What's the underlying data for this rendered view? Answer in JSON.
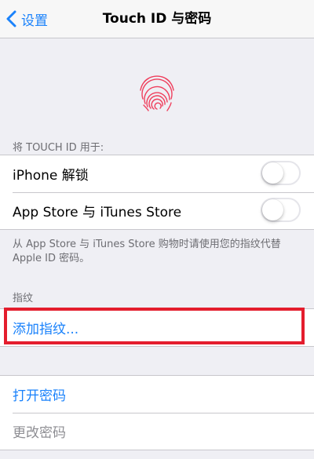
{
  "navbar": {
    "back_label": "设置",
    "title": "Touch ID 与密码"
  },
  "touchid_section": {
    "header": "将 TOUCH ID 用于:",
    "items": [
      {
        "label": "iPhone 解锁",
        "enabled": false
      },
      {
        "label": "App Store 与 iTunes Store",
        "enabled": false
      }
    ],
    "footnote": "从 App Store 与 iTunes Store 购物时请使用您的指纹代替 Apple ID 密码。"
  },
  "fingerprints_section": {
    "header": "指纹",
    "add_label": "添加指纹..."
  },
  "passcode_section": {
    "turn_on_label": "打开密码",
    "change_label": "更改密码"
  },
  "colors": {
    "accent": "#1a82fb",
    "background": "#efeff4",
    "fingerprint": "#ef3e5c",
    "highlight": "#e41d2d"
  },
  "icons": {
    "back": "chevron-left-icon",
    "fingerprint": "fingerprint-icon"
  }
}
